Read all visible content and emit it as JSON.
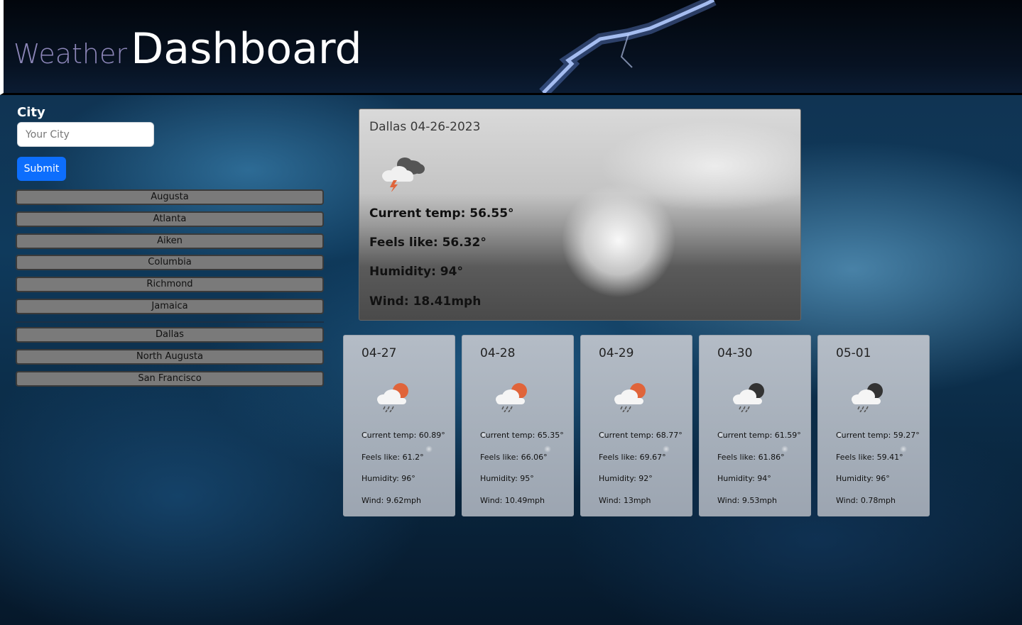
{
  "header": {
    "title_small": "Weather",
    "title_big": "Dashboard"
  },
  "sidebar": {
    "city_label": "City",
    "city_input": {
      "value": "",
      "placeholder": "Your City"
    },
    "submit_label": "Submit",
    "history": [
      "Augusta",
      "Atlanta",
      "Aiken",
      "Columbia",
      "Richmond",
      "Jamaica",
      "Dallas",
      "North Augusta",
      "San Francisco"
    ]
  },
  "today": {
    "title": "Dallas 04-26-2023",
    "icon": "thunderstorm-cloud-icon",
    "current_temp": "Current temp: 56.55°",
    "feels_like": "Feels like: 56.32°",
    "humidity": "Humidity: 94°",
    "wind": "Wind: 18.41mph"
  },
  "forecast": [
    {
      "date": "04-27",
      "icon": "rain-cloud-sun-icon",
      "current_temp": "Current temp: 60.89°",
      "feels_like": "Feels like: 61.2°",
      "humidity": "Humidity: 96°",
      "wind": "Wind: 9.62mph"
    },
    {
      "date": "04-28",
      "icon": "rain-cloud-sun-icon",
      "current_temp": "Current temp: 65.35°",
      "feels_like": "Feels like: 66.06°",
      "humidity": "Humidity: 95°",
      "wind": "Wind: 10.49mph"
    },
    {
      "date": "04-29",
      "icon": "rain-cloud-sun-icon",
      "current_temp": "Current temp: 68.77°",
      "feels_like": "Feels like: 69.67°",
      "humidity": "Humidity: 92°",
      "wind": "Wind: 13mph"
    },
    {
      "date": "04-30",
      "icon": "rain-cloud-moon-icon",
      "current_temp": "Current temp: 61.59°",
      "feels_like": "Feels like: 61.86°",
      "humidity": "Humidity: 94°",
      "wind": "Wind: 9.53mph"
    },
    {
      "date": "05-01",
      "icon": "rain-cloud-moon-icon",
      "current_temp": "Current temp: 59.27°",
      "feels_like": "Feels like: 59.41°",
      "humidity": "Humidity: 96°",
      "wind": "Wind: 0.78mph"
    }
  ],
  "colors": {
    "submit": "#0d6efd",
    "history_button": "#7a7a7a",
    "title_small": "#8c86b8",
    "sun": "#e0643a",
    "moon": "#333333"
  }
}
